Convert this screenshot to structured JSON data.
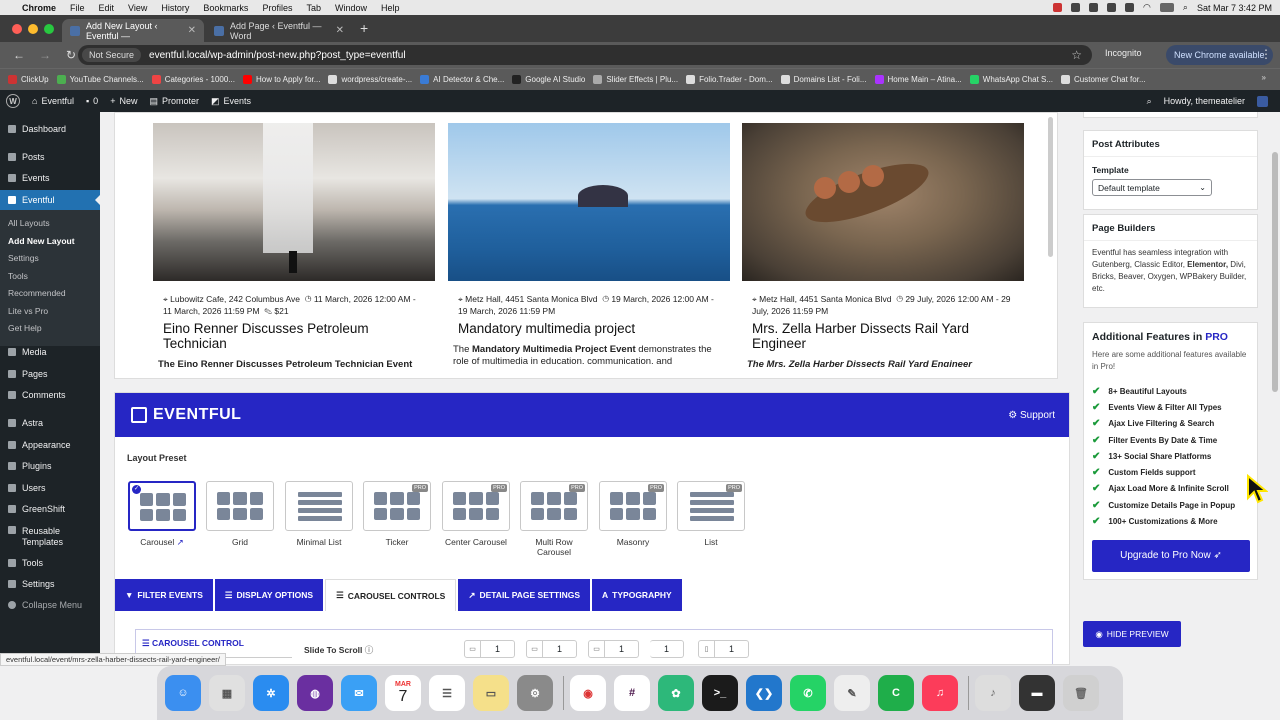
{
  "mac": {
    "app": "Chrome",
    "menus": [
      "File",
      "Edit",
      "View",
      "History",
      "Bookmarks",
      "Profiles",
      "Tab",
      "Window",
      "Help"
    ],
    "clock": "Sat Mar 7  3:42 PM"
  },
  "browser": {
    "tabs": [
      {
        "title": "Add New Layout ‹ Eventful —",
        "active": true
      },
      {
        "title": "Add Page ‹ Eventful — Word",
        "active": false
      }
    ],
    "not_secure": "Not Secure",
    "url": "eventful.local/wp-admin/post-new.php?post_type=eventful",
    "incognito": "Incognito",
    "new_chrome": "New Chrome available",
    "bookmarks": [
      "ClickUp",
      "YouTube Channels...",
      "Categories - 1000...",
      "How to Apply for...",
      "wordpress/create-...",
      "AI Detector & Che...",
      "Google AI Studio",
      "Slider Effects | Plu...",
      "Folio.Trader - Dom...",
      "Domains List - Foli...",
      "Home Main – Atina...",
      "WhatsApp Chat S...",
      "Customer Chat for..."
    ]
  },
  "wp_admin_bar": {
    "site": "Eventful",
    "comments": "0",
    "new": "New",
    "promoter": "Promoter",
    "events": "Events",
    "howdy": "Howdy, themeatelier"
  },
  "sidebar": {
    "items": [
      {
        "label": "Dashboard"
      },
      {
        "label": "Posts"
      },
      {
        "label": "Events"
      },
      {
        "label": "Eventful"
      },
      {
        "label": "Media"
      },
      {
        "label": "Pages"
      },
      {
        "label": "Comments"
      },
      {
        "label": "Astra"
      },
      {
        "label": "Appearance"
      },
      {
        "label": "Plugins"
      },
      {
        "label": "Users"
      },
      {
        "label": "GreenShift"
      },
      {
        "label": "Reusable Templates"
      },
      {
        "label": "Tools"
      },
      {
        "label": "Settings"
      },
      {
        "label": "Collapse Menu"
      }
    ],
    "submenu": [
      "All Layouts",
      "Add New Layout",
      "Settings",
      "Tools",
      "Recommended",
      "Lite vs Pro",
      "Get Help"
    ]
  },
  "events": [
    {
      "venue": "Lubowitz Cafe, 242 Columbus Ave",
      "date": "11 March, 2026 12:00 AM - 11 March, 2026 11:59 PM",
      "price": "$21",
      "title": "Eino Renner Discusses Petroleum Technician",
      "desc": "The Eino Renner Discusses Petroleum Technician Event"
    },
    {
      "venue": "Metz Hall, 4451 Santa Monica Blvd",
      "date": "19 March, 2026 12:00 AM - 19 March, 2026 11:59 PM",
      "price": "",
      "title": "Mandatory multimedia project",
      "desc_prefix": "The ",
      "desc_bold": "Mandatory Multimedia Project Event",
      "desc_rest": " demonstrates the role of multimedia in education, communication, and"
    },
    {
      "venue": "Metz Hall, 4451 Santa Monica Blvd",
      "date": "29 July, 2026 12:00 AM - 29 July, 2026 11:59 PM",
      "price": "",
      "title": "Mrs. Zella Harber Dissects Rail Yard Engineer",
      "desc": "The Mrs. Zella Harber Dissects Rail Yard Engineer"
    }
  ],
  "builder": {
    "brand": "EVENTFUL",
    "support": "Support",
    "layout_preset_label": "Layout Preset",
    "presets": [
      {
        "label": "Carousel",
        "pro": false,
        "selected": true
      },
      {
        "label": "Grid",
        "pro": false,
        "selected": false
      },
      {
        "label": "Minimal List",
        "pro": false,
        "selected": false
      },
      {
        "label": "Ticker",
        "pro": true,
        "selected": false
      },
      {
        "label": "Center Carousel",
        "pro": true,
        "selected": false
      },
      {
        "label": "Multi Row Carousel",
        "pro": true,
        "selected": false
      },
      {
        "label": "Masonry",
        "pro": true,
        "selected": false
      },
      {
        "label": "List",
        "pro": true,
        "selected": false
      }
    ],
    "pro_badge": "PRO",
    "tabs": [
      "FILTER EVENTS",
      "DISPLAY OPTIONS",
      "CAROUSEL CONTROLS",
      "DETAIL PAGE SETTINGS",
      "TYPOGRAPHY"
    ],
    "active_tab": "CAROUSEL CONTROLS",
    "carousel_control_title": "CAROUSEL CONTROL",
    "slide_to_scroll_label": "Slide To Scroll",
    "slide_to_scroll_values": [
      "1",
      "1",
      "1",
      "1",
      "1"
    ]
  },
  "right": {
    "post_attributes_title": "Post Attributes",
    "template_label": "Template",
    "template_value": "Default template",
    "page_builders_title": "Page Builders",
    "page_builders_text_1": "Eventful has seamless integration with Gutenberg, Classic Editor, ",
    "page_builders_bold": "Elementor,",
    "page_builders_text_2": " Divi, Bricks, Beaver, Oxygen, WPBakery Builder, etc.",
    "additional_title": "Additional Features in ",
    "additional_pro": "PRO",
    "additional_sub": "Here are some additional features available in Pro!",
    "features": [
      "8+ Beautiful Layouts",
      "Events View & Filter All Types",
      "Ajax Live Filtering & Search",
      "Filter Events By Date & Time",
      "13+ Social Share Platforms",
      "Custom Fields support",
      "Ajax Load More & Infinite Scroll",
      "Customize Details Page in Popup",
      "100+ Customizations & More"
    ],
    "upgrade": "Upgrade to Pro Now",
    "hide_preview": "HIDE PREVIEW"
  },
  "status_url": "eventful.local/event/mrs-zella-harber-dissects-rail-yard-engineer/",
  "dock": {
    "calendar_month": "MAR",
    "calendar_day": "7"
  },
  "colors": {
    "accent": "#2626c4",
    "wp_dark": "#1d2327",
    "wp_blue": "#2271b1",
    "check_green": "#1a9a3a"
  }
}
